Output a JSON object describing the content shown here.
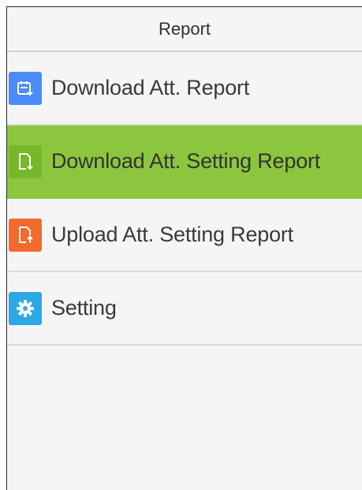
{
  "header": {
    "title": "Report"
  },
  "menu": {
    "items": [
      {
        "label": "Download Att. Report",
        "icon": "calendar-download-icon",
        "icon_color": "#4a8cf7",
        "selected": false
      },
      {
        "label": "Download Att. Setting Report",
        "icon": "document-download-icon",
        "icon_color": "#76b82a",
        "selected": true
      },
      {
        "label": "Upload Att. Setting Report",
        "icon": "document-upload-icon",
        "icon_color": "#f26b2e",
        "selected": false
      },
      {
        "label": "Setting",
        "icon": "gear-icon",
        "icon_color": "#2aa9e6",
        "selected": false
      }
    ]
  },
  "colors": {
    "selected_background": "#8cc63f",
    "background": "#f5f5f5",
    "divider": "#dadada"
  }
}
